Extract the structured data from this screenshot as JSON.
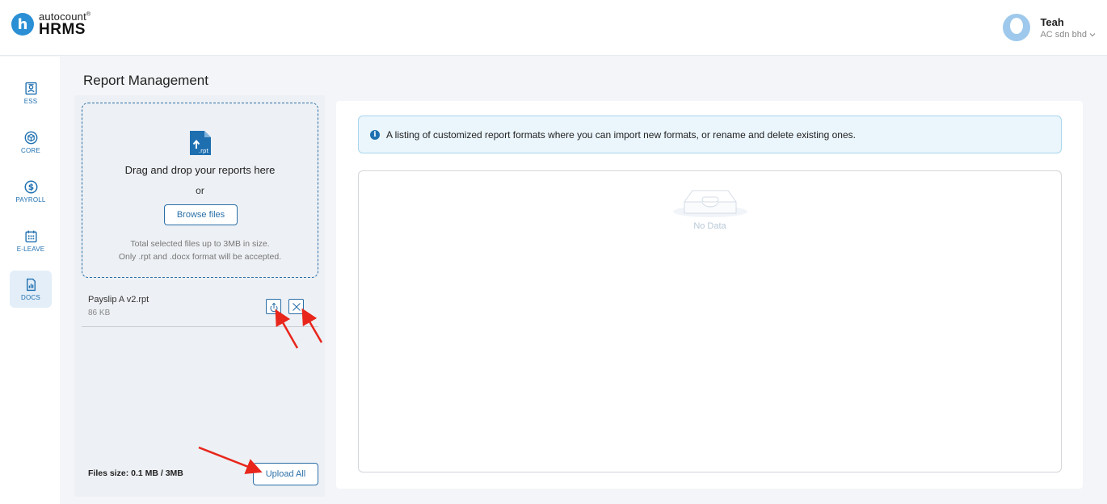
{
  "app": {
    "logo_small": "autocount",
    "logo_mark": "®",
    "logo_big": "HRMS",
    "logo_letter": "h"
  },
  "user": {
    "name": "Teah",
    "company": "AC sdn bhd",
    "dropdown_icon": "chevron-down-icon"
  },
  "sidebar": {
    "items": [
      {
        "label": "ESS",
        "icon": "id-card-icon"
      },
      {
        "label": "CORE",
        "icon": "cube-icon"
      },
      {
        "label": "PAYROLL",
        "icon": "dollar-circle-icon"
      },
      {
        "label": "E-LEAVE",
        "icon": "calendar-icon"
      },
      {
        "label": "DOCS",
        "icon": "document-chart-icon",
        "active": true
      }
    ]
  },
  "page": {
    "title": "Report Management"
  },
  "upload": {
    "file_icon_text": ".rpt",
    "drag_text": "Drag and drop your reports here",
    "or_text": "or",
    "browse_label": "Browse files",
    "note_line1": "Total selected files up to 3MB in size.",
    "note_line2": "Only .rpt and .docx format will be accepted.",
    "files": [
      {
        "name": "Payslip A v2.rpt",
        "size": "86 KB"
      }
    ],
    "files_size_text": "Files size: 0.1 MB / 3MB",
    "upload_all_label": "Upload All"
  },
  "listing": {
    "info_text": "A listing of customized report formats where you can import new formats, or rename and delete existing ones.",
    "info_icon_glyph": "i",
    "empty_text": "No Data"
  },
  "colors": {
    "accent": "#2a6fa8",
    "brand": "#2a8fd4",
    "annotation": "#e8261c"
  }
}
